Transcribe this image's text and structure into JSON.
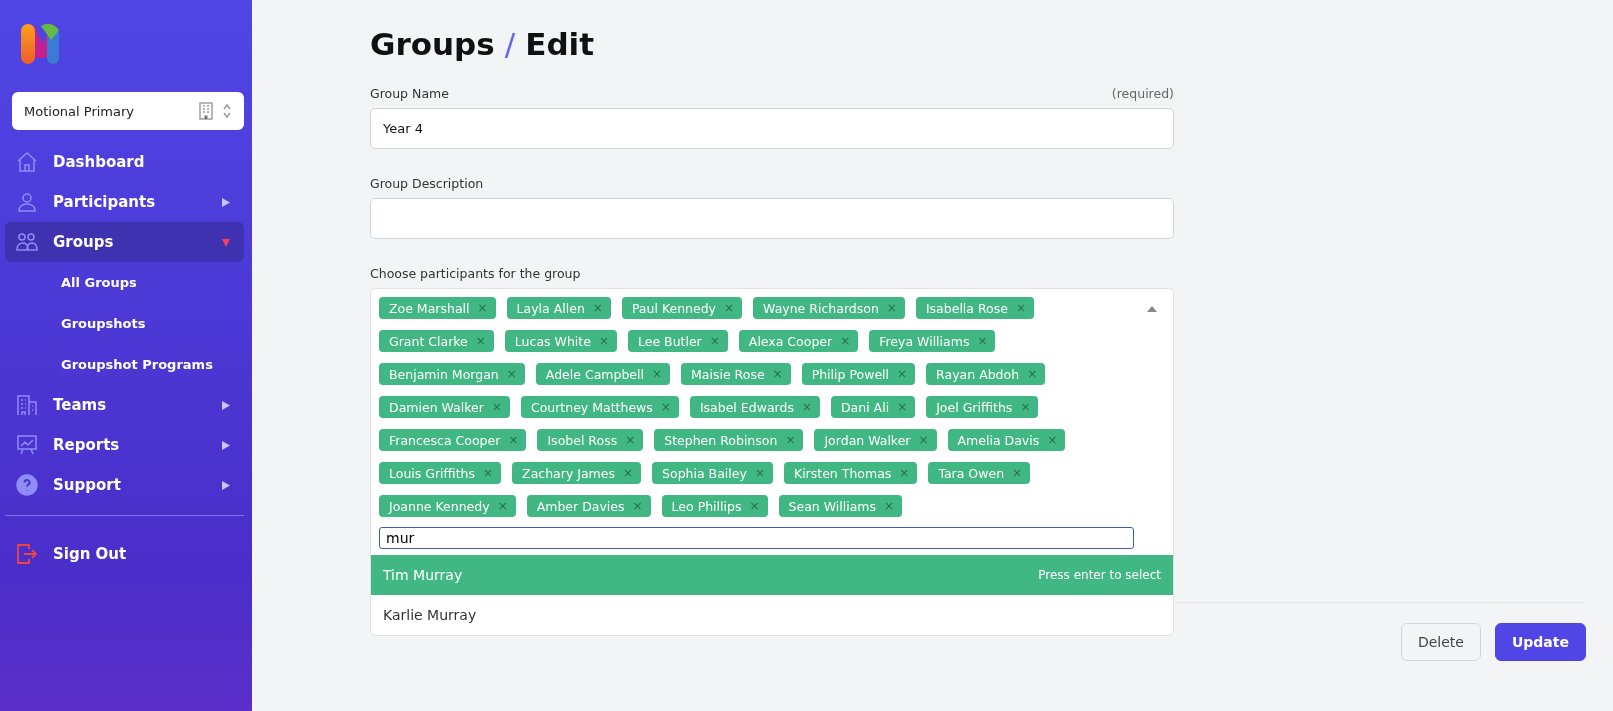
{
  "organisation": {
    "name": "Motional Primary"
  },
  "nav": [
    {
      "label": "Dashboard",
      "kind": "link",
      "selected": false
    },
    {
      "label": "Participants",
      "kind": "menu",
      "selected": false,
      "expanded": false
    },
    {
      "label": "Groups",
      "kind": "menu",
      "selected": true,
      "expanded": true,
      "children": [
        {
          "label": "All Groups"
        },
        {
          "label": "Groupshots"
        },
        {
          "label": "Groupshot Programs"
        }
      ]
    },
    {
      "label": "Teams",
      "kind": "menu",
      "selected": false,
      "expanded": false
    },
    {
      "label": "Reports",
      "kind": "menu",
      "selected": false,
      "expanded": false
    },
    {
      "label": "Support",
      "kind": "menu",
      "selected": false,
      "expanded": false
    }
  ],
  "sign_out": {
    "label": "Sign Out"
  },
  "breadcrumb": {
    "section": "Groups",
    "separator": "/",
    "page": "Edit"
  },
  "group_name": {
    "label": "Group Name",
    "required_note": "(required)",
    "value": "Year 4"
  },
  "group_description": {
    "label": "Group Description"
  },
  "participants": {
    "label": "Choose participants for the group",
    "search_value": "mur",
    "selected_tags": [
      {
        "name": "Zoe Marshall"
      },
      {
        "name": "Layla Allen"
      },
      {
        "name": "Paul Kennedy"
      },
      {
        "name": "Wayne Richardson"
      },
      {
        "name": "Isabella Rose"
      },
      {
        "name": "Grant Clarke"
      },
      {
        "name": "Lucas White"
      },
      {
        "name": "Lee Butler"
      },
      {
        "name": "Alexa Cooper"
      },
      {
        "name": "Freya Williams"
      },
      {
        "name": "Benjamin Morgan"
      },
      {
        "name": "Adele Campbell"
      },
      {
        "name": "Maisie Rose"
      },
      {
        "name": "Philip Powell"
      },
      {
        "name": "Rayan Abdoh"
      },
      {
        "name": "Damien Walker"
      },
      {
        "name": "Courtney Matthews"
      },
      {
        "name": "Isabel Edwards"
      },
      {
        "name": "Dani Ali"
      },
      {
        "name": "Joel Griffiths"
      },
      {
        "name": "Francesca Cooper"
      },
      {
        "name": "Isobel Ross"
      },
      {
        "name": "Stephen Robinson"
      },
      {
        "name": "Jordan Walker"
      },
      {
        "name": "Amelia Davis"
      },
      {
        "name": "Louis Griffiths"
      },
      {
        "name": "Zachary James"
      },
      {
        "name": "Sophia Bailey"
      },
      {
        "name": "Kirsten Thomas"
      },
      {
        "name": "Tara Owen"
      },
      {
        "name": "Joanne Kennedy"
      },
      {
        "name": "Amber Davies"
      },
      {
        "name": "Leo Phillips"
      },
      {
        "name": "Sean Williams"
      }
    ],
    "tag_remove": "×",
    "options": [
      {
        "name": "Tim Murray",
        "selected": true,
        "hint": "Press enter to select"
      },
      {
        "name": "Karlie Murray",
        "selected": false
      }
    ]
  },
  "buttons": [
    {
      "label": "Delete",
      "kind": "secondary"
    },
    {
      "label": "Update",
      "kind": "primary"
    }
  ]
}
